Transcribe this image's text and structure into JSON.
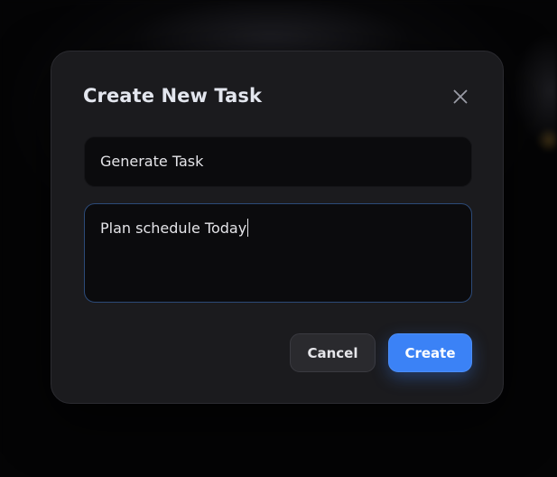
{
  "modal": {
    "title": "Create New Task",
    "close_icon": "close-icon",
    "title_input": {
      "value": "Generate Task"
    },
    "description_input": {
      "value": "Plan schedule Today"
    },
    "buttons": {
      "cancel_label": "Cancel",
      "create_label": "Create"
    }
  },
  "colors": {
    "accent": "#3b82f6",
    "modal_bg": "#1b1b1e",
    "input_bg": "#0b0b0d",
    "focus_border": "#2c4a78"
  }
}
